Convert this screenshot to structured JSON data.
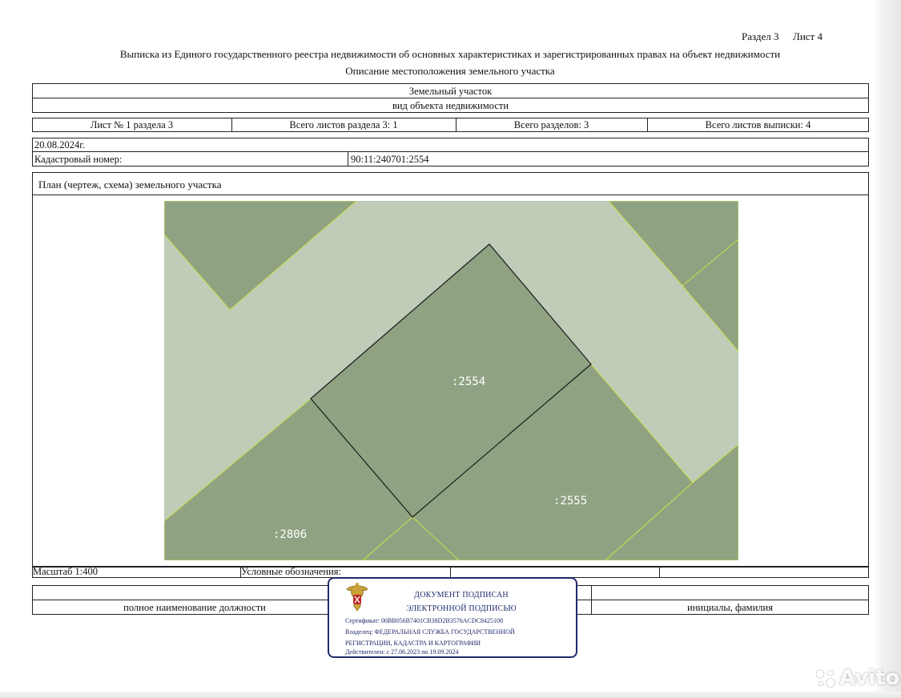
{
  "header": {
    "section": "Раздел 3",
    "sheet": "Лист 4",
    "title": "Выписка из Единого государственного реестра недвижимости об основных характеристиках и зарегистрированных правах на объект недвижимости",
    "subtitle": "Описание местоположения земельного участка"
  },
  "object": {
    "type_value": "Земельный участок",
    "type_caption": "вид объекта недвижимости"
  },
  "sheets_row": {
    "sheet_of_section": "Лист № 1 раздела 3",
    "total_sheets_section": "Всего листов раздела 3: 1",
    "total_sections": "Всего разделов: 3",
    "total_sheets_extract": "Всего листов выписки: 4"
  },
  "meta": {
    "date": "20.08.2024г.",
    "cadastral_label": "Кадастровый номер:",
    "cadastral_value": "90:11:240701:2554"
  },
  "plan": {
    "title": "План (чертеж, схема) земельного участка",
    "labels": {
      "main": ":2554",
      "right": ":2555",
      "left": ":2806"
    },
    "colors": {
      "parcel_fill": "#8fa282",
      "road_fill": "#c0cbb8",
      "parcel_edge": "#c9e04a",
      "outline": "#1a1a1a"
    }
  },
  "legend_row": {
    "scale": "Масштаб 1:400",
    "legend_label": "Условные обозначения:"
  },
  "signature_row": {
    "position_caption": "полное наименование должности",
    "initials_caption": "инициалы, фамилия"
  },
  "stamp": {
    "line1": "ДОКУМЕНТ ПОДПИСАН",
    "line2": "ЭЛЕКТРОННОЙ ПОДПИСЬЮ",
    "certificate": "Сертификат: 00BB056B7401CB38D2B3576ACDC8425108",
    "owner_line1": "Владелец: ФЕДЕРАЛЬНАЯ СЛУЖБА ГОСУДАРСТВЕННОЙ",
    "owner_line2": "РЕГИСТРАЦИИ, КАДАСТРА И КАРТОГРАФИИ",
    "valid": "Действителен: с 27.06.2023 по 19.09.2024",
    "accent_color": "#1f2a6b"
  },
  "watermark": {
    "text": "Avito",
    "icon": "avito-dots-icon"
  }
}
